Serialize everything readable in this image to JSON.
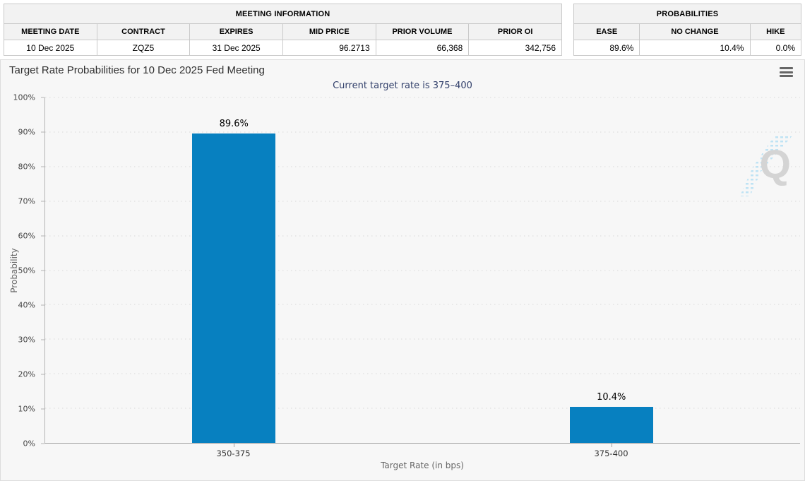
{
  "meeting_info": {
    "title": "MEETING INFORMATION",
    "columns": [
      "MEETING DATE",
      "CONTRACT",
      "EXPIRES",
      "MID PRICE",
      "PRIOR VOLUME",
      "PRIOR OI"
    ],
    "values": [
      "10 Dec 2025",
      "ZQZ5",
      "31 Dec 2025",
      "96.2713",
      "66,368",
      "342,756"
    ]
  },
  "probabilities": {
    "title": "PROBABILITIES",
    "columns": [
      "EASE",
      "NO CHANGE",
      "HIKE"
    ],
    "values": [
      "89.6%",
      "10.4%",
      "0.0%"
    ]
  },
  "chart_data": {
    "type": "bar",
    "title": "Target Rate Probabilities for 10 Dec 2025 Fed Meeting",
    "subtitle": "Current target rate is 375–400",
    "categories": [
      "350-375",
      "375-400"
    ],
    "values": [
      89.6,
      10.4
    ],
    "data_labels": [
      "89.6%",
      "10.4%"
    ],
    "xlabel": "Target Rate (in bps)",
    "ylabel": "Probability",
    "ylim": [
      0,
      100
    ],
    "ytick_step": 10,
    "ytick_suffix": "%",
    "bar_color": "#0780c0",
    "subtitle_color": "#32406b",
    "grid": "dotted-horizontal",
    "legend": "none"
  },
  "icons": {
    "menu": "hamburger-menu-icon",
    "watermark_letter": "Q"
  }
}
